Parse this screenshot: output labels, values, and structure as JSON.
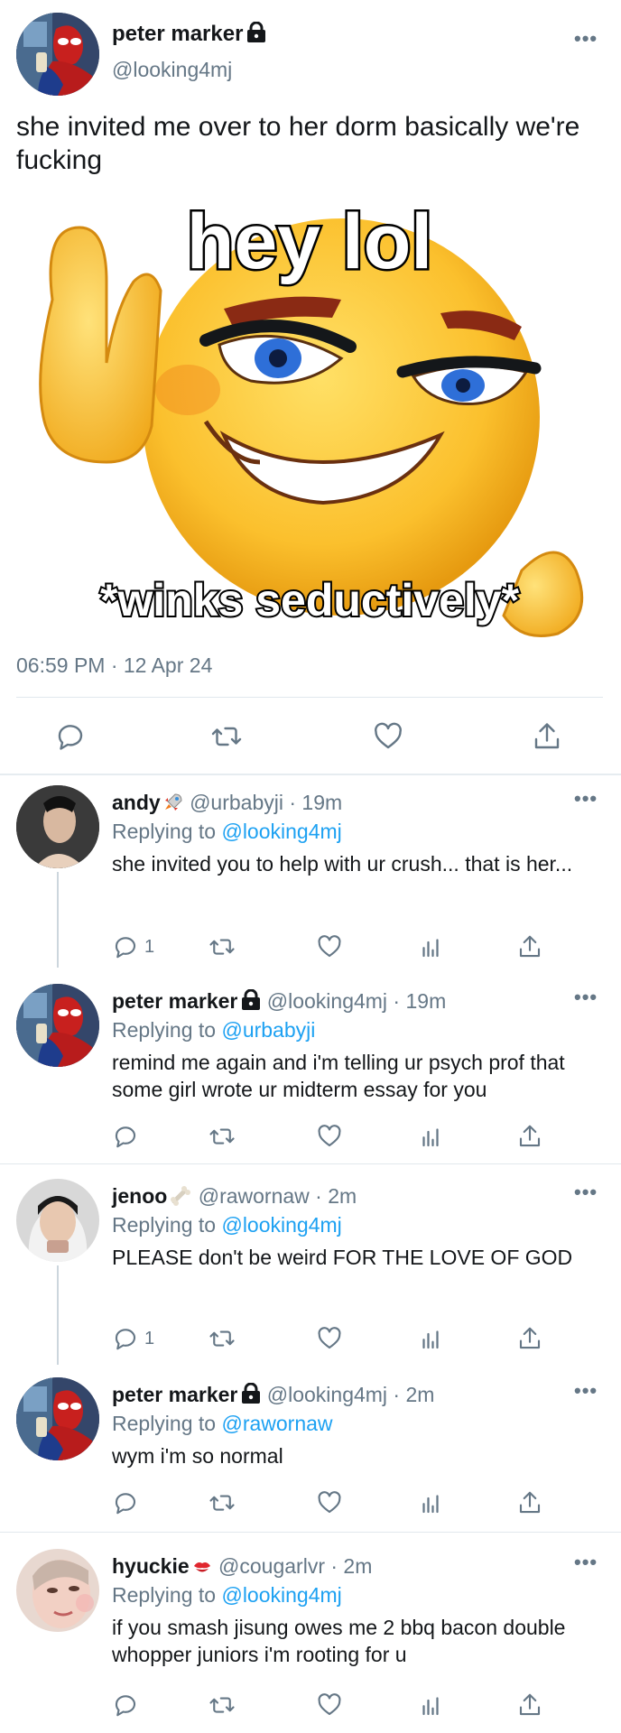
{
  "main_tweet": {
    "display_name": "peter marker",
    "handle": "@looking4mj",
    "text": "she invited me over to her dorm basically we're fucking",
    "meme_top_text": "hey lol",
    "meme_bottom_text": "*winks seductively*",
    "timestamp": "06:59 PM · 12 Apr 24",
    "more_label": "•••"
  },
  "replies": [
    {
      "display_name": "andy",
      "emoji": "rocket-icon",
      "meta": "@urbabyji · 19m",
      "replying_prefix": "Replying to",
      "replying_to": "@looking4mj",
      "text": "she invited you to help with ur crush... that is her...",
      "reply_count": "1"
    },
    {
      "display_name": "peter marker",
      "emoji": "lock-icon",
      "meta": "@looking4mj · 19m",
      "replying_prefix": "Replying to",
      "replying_to": "@urbabyji",
      "text": "remind me again and i'm telling ur psych prof that some girl wrote ur midterm essay for you",
      "reply_count": ""
    },
    {
      "display_name": "jenoo",
      "emoji": "bone-icon",
      "meta": "@rawornaw · 2m",
      "replying_prefix": "Replying to",
      "replying_to": "@looking4mj",
      "text": "PLEASE don't be weird FOR THE LOVE OF GOD",
      "reply_count": "1"
    },
    {
      "display_name": "peter marker",
      "emoji": "lock-icon",
      "meta": "@looking4mj · 2m",
      "replying_prefix": "Replying to",
      "replying_to": "@rawornaw",
      "text": "wym i'm so normal",
      "reply_count": ""
    },
    {
      "display_name": "hyuckie",
      "emoji": "kiss-mark-icon",
      "meta": "@cougarlvr · 2m",
      "replying_prefix": "Replying to",
      "replying_to": "@looking4mj",
      "text": "if you smash jisung owes me 2 bbq bacon double whopper juniors i'm rooting for u",
      "reply_count": ""
    }
  ],
  "colors": {
    "link": "#1da1f2",
    "secondary_text": "#657786",
    "divider": "#e1e8ed",
    "emoji_yellow": "#fbc02d"
  }
}
